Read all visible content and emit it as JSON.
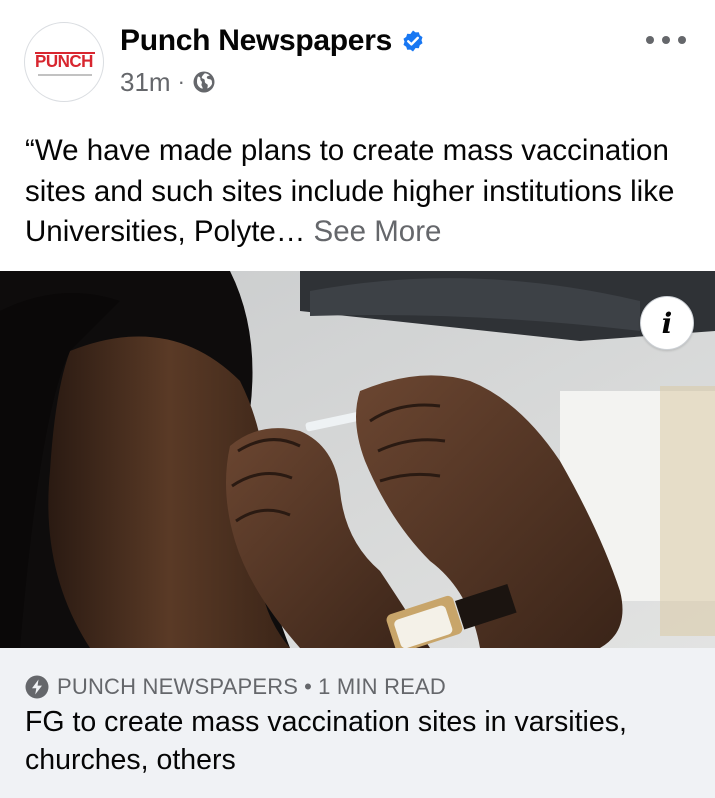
{
  "post": {
    "page_name": "Punch Newspapers",
    "avatar_logo_text": "PUNCH",
    "verified_icon": "verified-badge-icon",
    "time": "31m",
    "separator": "·",
    "audience_icon": "globe-icon",
    "more_icon": "more-options-icon",
    "text": "“We have made plans to create mass vaccination sites and such sites include higher institutions like Universities, Polyte…",
    "see_more": "See More"
  },
  "image": {
    "info_label": "i",
    "description_icon": "vaccination-photo"
  },
  "link_preview": {
    "source_icon": "instant-article-bolt-icon",
    "source": "PUNCH NEWSPAPERS",
    "separator": "•",
    "read_time": "1 MIN READ",
    "headline": "FG to create mass vaccination sites in varsities, churches, others"
  },
  "colors": {
    "brand_red": "#d8262f",
    "verified_blue": "#1877f2",
    "secondary_text": "#65676b",
    "card_background": "#f0f2f5"
  }
}
